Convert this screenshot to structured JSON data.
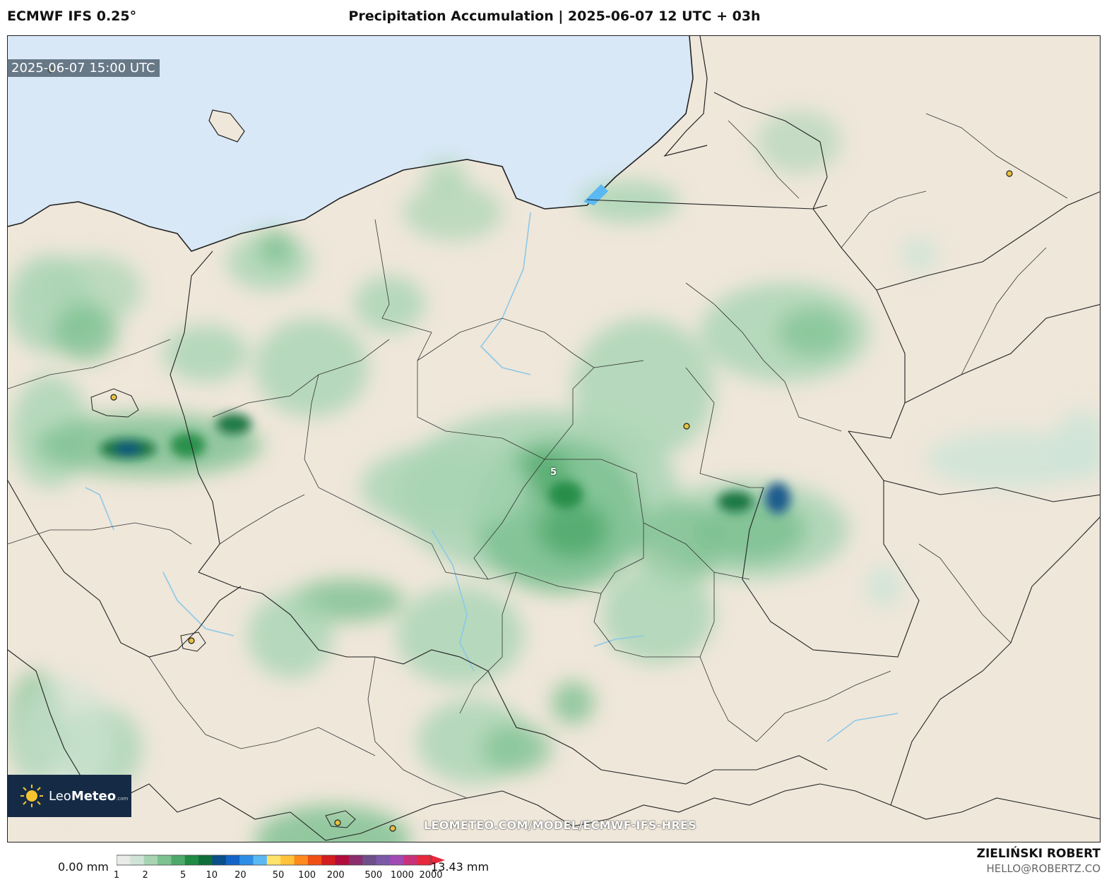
{
  "header": {
    "model": "ECMWF IFS 0.25°",
    "title": "Precipitation Accumulation | 2025-06-07 12 UTC + 03h"
  },
  "map": {
    "valid_time": "2025-06-07 15:00 UTC",
    "watermark": "LEOMETEO.COM/MODEL/ECMWF-IFS-HRES",
    "max_label": "5",
    "colors": {
      "land": "#efe7da",
      "sea": "#d9e8f6",
      "river": "#8cc8e8",
      "border": "#222222"
    }
  },
  "logo": {
    "brand_light": "Leo",
    "brand_bold": "Meteo",
    "suffix": ".com"
  },
  "colorbar": {
    "min_label": "0.00 mm",
    "max_label": "13.43 mm",
    "ticks": [
      "1",
      "2",
      "5",
      "10",
      "20",
      "50",
      "100",
      "200",
      "500",
      "1000",
      "2000"
    ],
    "colors": [
      "#e8ebe8",
      "#cfe4d6",
      "#a8d4b4",
      "#7cc190",
      "#4ea86a",
      "#1f8a43",
      "#0f6e3a",
      "#0a4f8a",
      "#1464c8",
      "#2f8ee6",
      "#5ab8f2",
      "#ffe36a",
      "#ffc23a",
      "#ff8a1e",
      "#f05014",
      "#d21e1e",
      "#b00c3c",
      "#8c2d6e",
      "#6e4f8a",
      "#7a5aa8",
      "#a04ab4",
      "#c83278",
      "#e8283c"
    ]
  },
  "credit": {
    "author": "ZIELIŃSKI ROBERT",
    "email": "HELLO@ROBERTZ.CO"
  }
}
